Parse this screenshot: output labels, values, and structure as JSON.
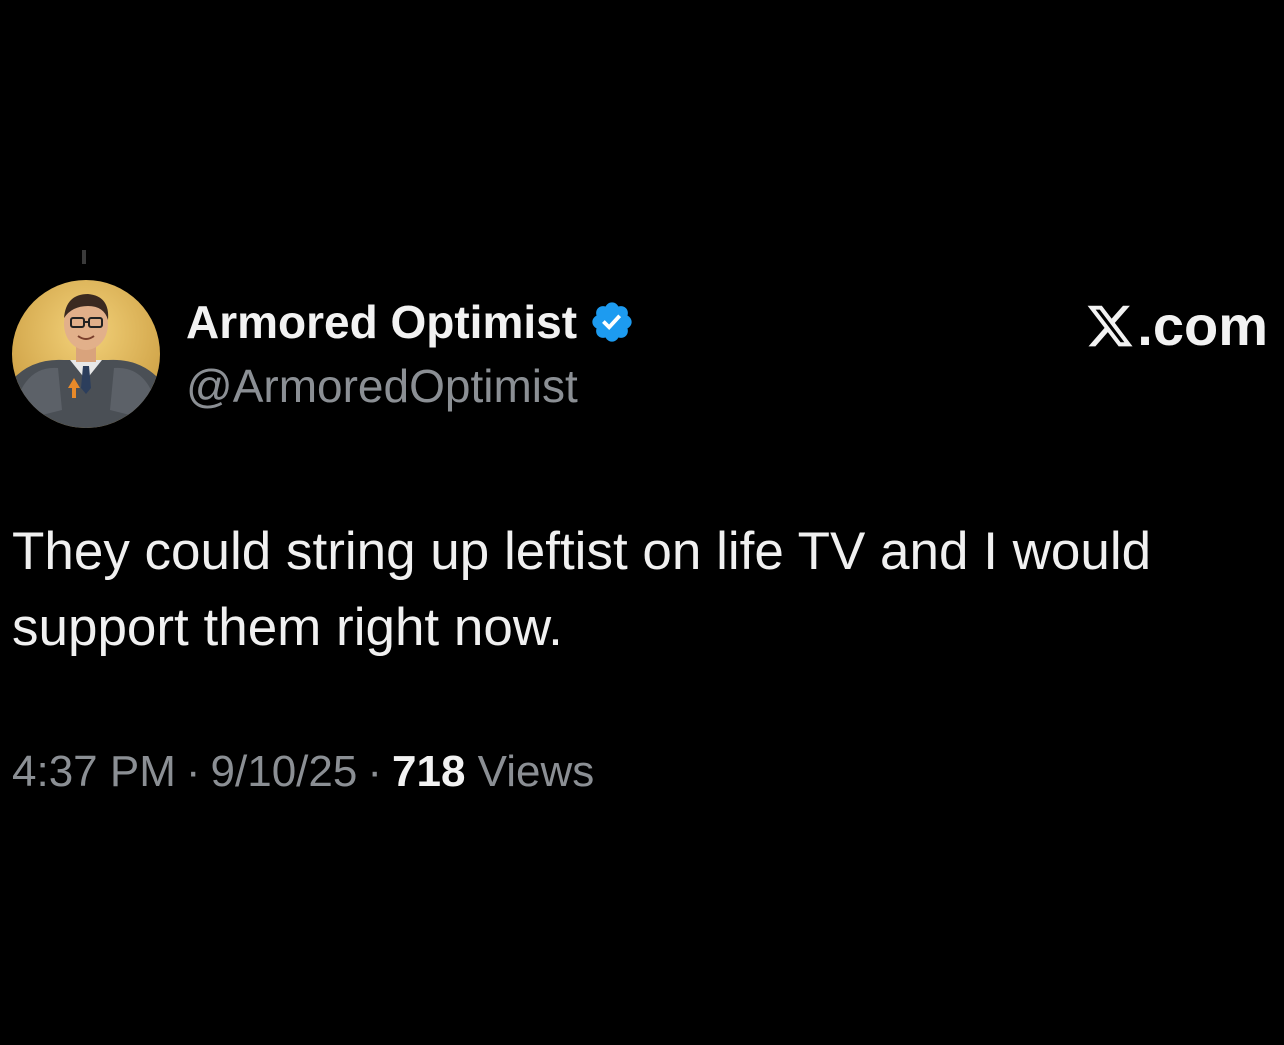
{
  "tweet": {
    "author": {
      "display_name": "Armored Optimist",
      "handle": "@ArmoredOptimist",
      "verified": true,
      "verified_icon": "verified-badge-icon",
      "avatar": "avatar-armored-man-icon"
    },
    "site_label": "X.com",
    "site_label_suffix": ".com",
    "text": "They could string up leftist on life TV and I would support them right now.",
    "time": "4:37 PM",
    "date": "9/10/25",
    "separator": "·",
    "views_count": "718",
    "views_label": "Views"
  },
  "colors": {
    "background": "#000000",
    "primary_text": "#f2f2f2",
    "secondary_text": "#8b8f94",
    "verified_blue": "#1d9bf0"
  }
}
